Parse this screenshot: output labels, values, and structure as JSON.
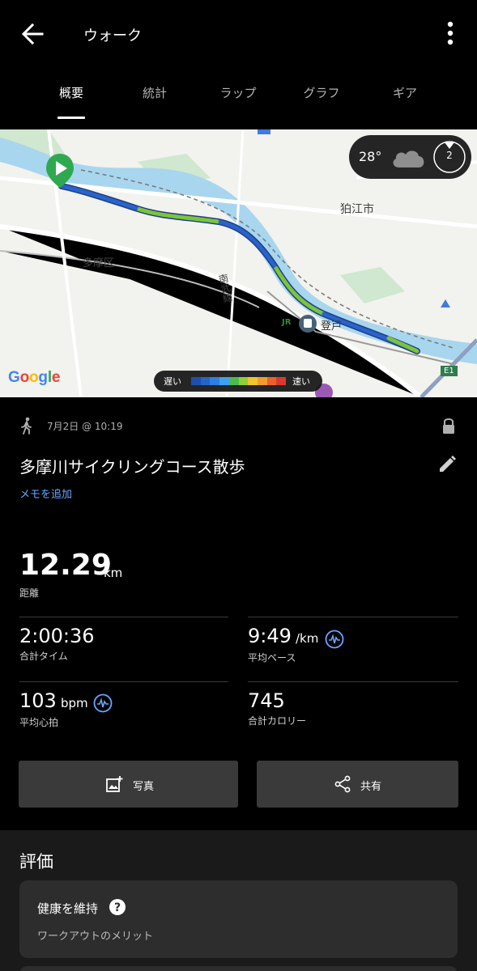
{
  "header": {
    "title": "ウォーク"
  },
  "tabs": [
    {
      "label": "概要",
      "active": true
    },
    {
      "label": "統計",
      "active": false
    },
    {
      "label": "ラップ",
      "active": false
    },
    {
      "label": "グラフ",
      "active": false
    },
    {
      "label": "ギア",
      "active": false
    }
  ],
  "map": {
    "labels": {
      "komae": "狛江市",
      "tama": "多摩区",
      "nambu_line": "南武線",
      "noborito": "登戸",
      "jr": "JR",
      "e1": "E1"
    },
    "weather": {
      "temperature": "28°",
      "condition_icon": "cloud-icon",
      "wind_speed": "2"
    },
    "google_logo": "Google",
    "legend": {
      "slow": "遅い",
      "fast": "速い",
      "colors": [
        "#1f4fae",
        "#2565c8",
        "#2f7fe0",
        "#3ea0f0",
        "#4dbb4a",
        "#8fcf3a",
        "#f2c230",
        "#f29b30",
        "#e8622c",
        "#d93a2f"
      ]
    }
  },
  "activity": {
    "type_icon": "walk-icon",
    "date": "7月2日 @ 10:19",
    "name": "多摩川サイクリングコース散歩",
    "add_memo": "メモを追加"
  },
  "stats": {
    "distance": {
      "value": "12.29",
      "unit": "km",
      "label": "距離"
    },
    "total_time": {
      "value": "2:00:36",
      "label": "合計タイム"
    },
    "avg_pace": {
      "value": "9:49",
      "unit": "/km",
      "label": "平均ペース"
    },
    "avg_hr": {
      "value": "103",
      "unit": "bpm",
      "label": "平均心拍"
    },
    "calories": {
      "value": "745",
      "label": "合計カロリー"
    }
  },
  "buttons": {
    "photo": "写真",
    "share": "共有"
  },
  "rating": {
    "section_title": "評価",
    "card_title": "健康を維持",
    "card_subtitle": "ワークアウトのメリット"
  },
  "colors": {
    "background": "#000000",
    "link": "#6aa6ff",
    "button": "#3a3a3a",
    "route_blue": "#2a63c9",
    "route_green": "#7cc43a"
  }
}
